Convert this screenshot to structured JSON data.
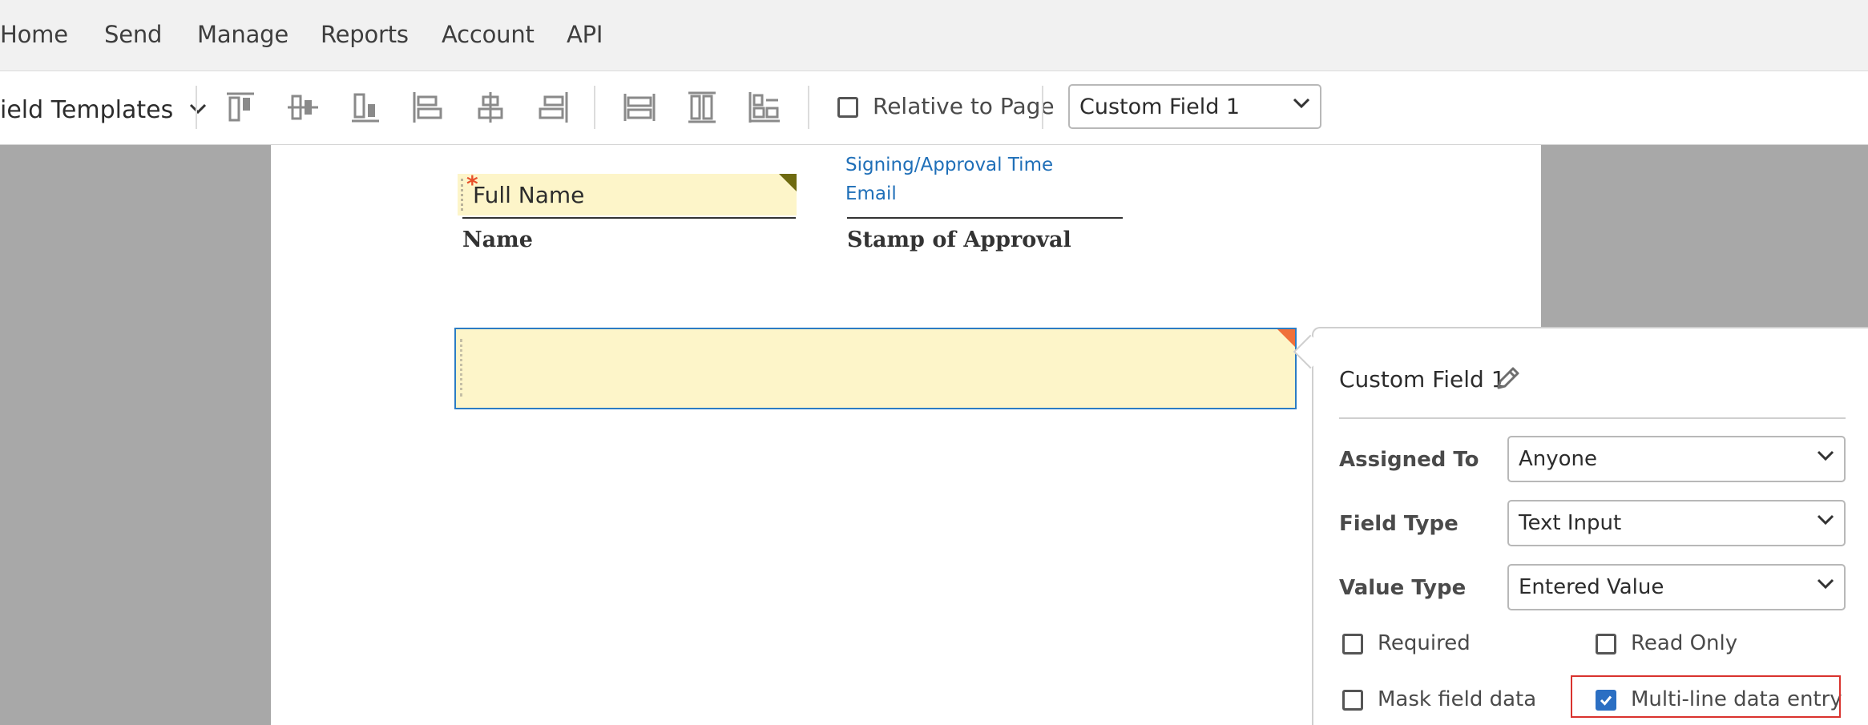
{
  "nav": {
    "items": [
      {
        "label": "Home"
      },
      {
        "label": "Send"
      },
      {
        "label": "Manage"
      },
      {
        "label": "Reports"
      },
      {
        "label": "Account"
      },
      {
        "label": "API"
      }
    ]
  },
  "toolbar": {
    "templates_label": "ield Templates",
    "icons": [
      "align-top-icon",
      "align-middle-icon",
      "align-bottom-icon",
      "align-left-icon",
      "align-center-icon",
      "align-right-icon",
      "match-width-icon",
      "match-height-icon",
      "match-size-icon"
    ],
    "relative_to_page_label": "Relative to Page",
    "relative_to_page_checked": false,
    "field_select_value": "Custom Field 1"
  },
  "document": {
    "fullname_field_text": "Full Name",
    "name_label": "Name",
    "signing_time_link": "Signing/Approval Time",
    "email_link": "Email",
    "stamp_label": "Stamp of Approval"
  },
  "properties": {
    "title": "Custom Field 1",
    "assigned_to_label": "Assigned To",
    "assigned_to_value": "Anyone",
    "field_type_label": "Field Type",
    "field_type_value": "Text Input",
    "value_type_label": "Value Type",
    "value_type_value": "Entered Value",
    "required_label": "Required",
    "required_checked": false,
    "read_only_label": "Read Only",
    "read_only_checked": false,
    "mask_label": "Mask field data",
    "mask_checked": false,
    "multiline_label": "Multi-line data entry",
    "multiline_checked": true
  },
  "colors": {
    "field_fill": "#fdf5c9",
    "selection_border": "#2c7cc4",
    "link": "#1f6fb8",
    "checkbox_checked": "#2b6fc3",
    "highlight": "#d9332e"
  }
}
